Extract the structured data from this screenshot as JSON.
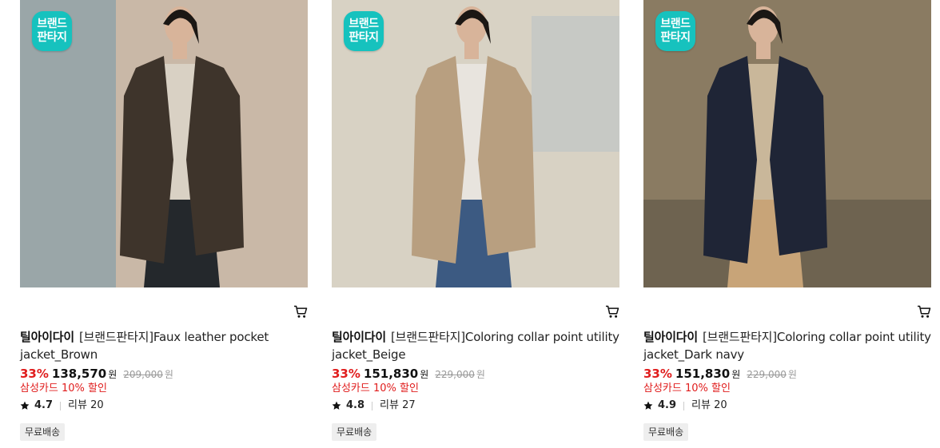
{
  "products": [
    {
      "badge": "브랜드\n판타지",
      "brand": "틸아이다이",
      "name": "[브랜드판타지]Faux leather pocket jacket_Brown",
      "discount": "33%",
      "price": "138,570",
      "currency": "원",
      "original_price": "209,000",
      "card_promo": "삼성카드 10% 할인",
      "rating": "4.7",
      "review_label": "리뷰",
      "review_count": "20",
      "shipping_tag": "무료배송",
      "photo": {
        "background": "#c9b8a7",
        "jacket_color": "#3e342b",
        "pants_color": "#24282c",
        "shirt_color": "#d9d1c4"
      }
    },
    {
      "badge": "브랜드\n판타지",
      "brand": "틸아이다이",
      "name": "[브랜드판타지]Coloring collar point utility jacket_Beige",
      "discount": "33%",
      "price": "151,830",
      "currency": "원",
      "original_price": "229,000",
      "card_promo": "삼성카드 10% 할인",
      "rating": "4.8",
      "review_label": "리뷰",
      "review_count": "27",
      "shipping_tag": "무료배송",
      "photo": {
        "background": "#d8d2c4",
        "jacket_color": "#b89f80",
        "pants_color": "#3c5a82",
        "shirt_color": "#e8e4de"
      }
    },
    {
      "badge": "브랜드\n판타지",
      "brand": "틸아이다이",
      "name": "[브랜드판타지]Coloring collar point utility jacket_Dark navy",
      "discount": "33%",
      "price": "151,830",
      "currency": "원",
      "original_price": "229,000",
      "card_promo": "삼성카드 10% 할인",
      "rating": "4.9",
      "review_label": "리뷰",
      "review_count": "20",
      "shipping_tag": "무료배송",
      "photo": {
        "background": "#8a7b62",
        "jacket_color": "#1f2536",
        "pants_color": "#c8a478",
        "shirt_color": "#c9b79a"
      }
    }
  ],
  "colors": {
    "accent_discount": "#e01d1d",
    "badge_bg": "#16c2be"
  },
  "icons": {
    "cart": "cart-icon",
    "star": "star-icon"
  }
}
